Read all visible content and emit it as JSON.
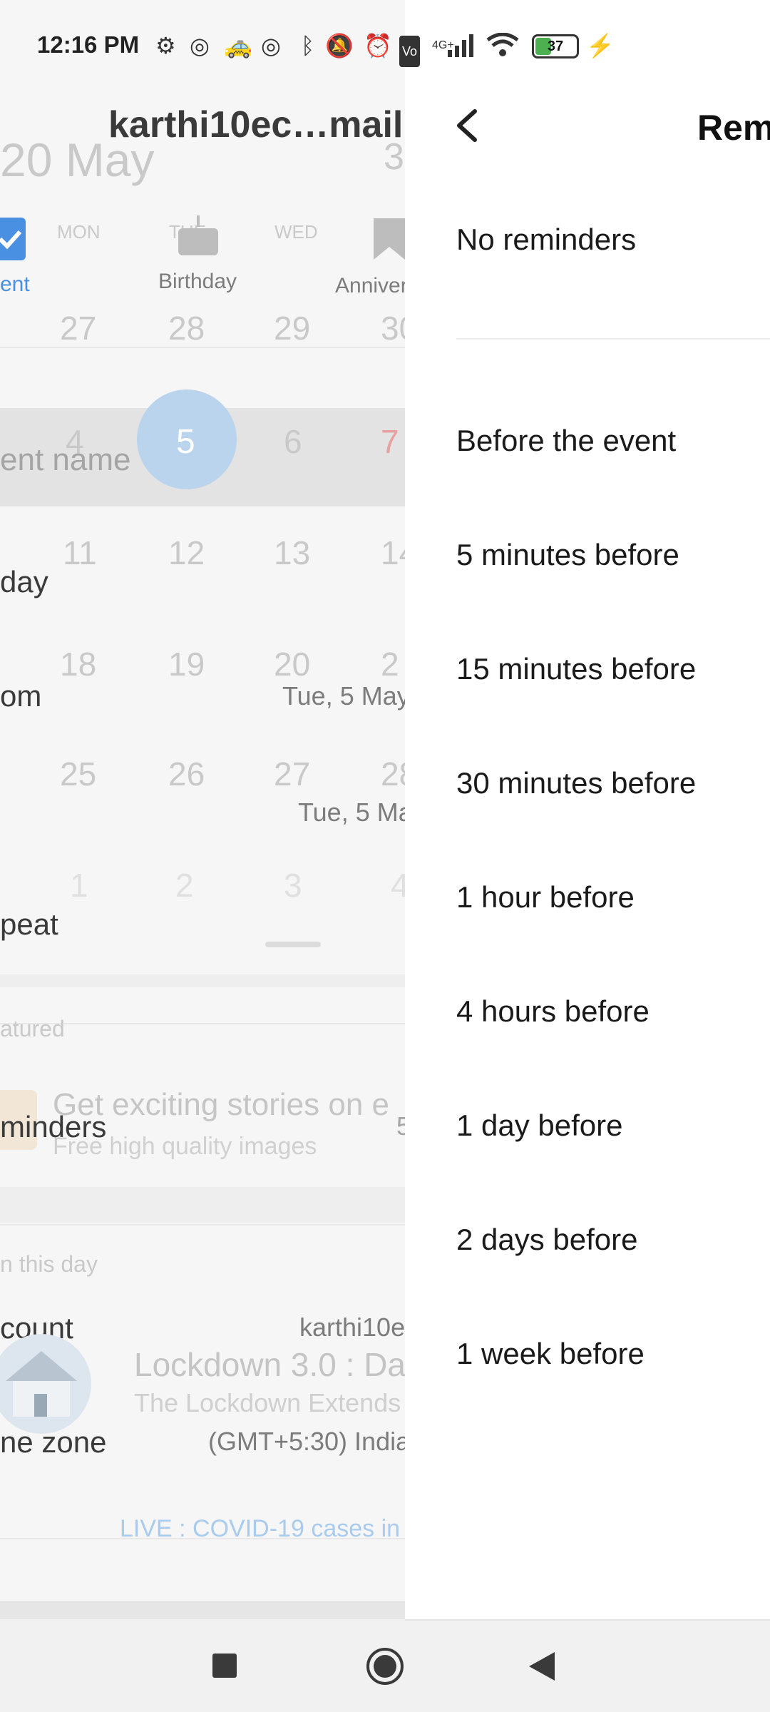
{
  "status_bar": {
    "time": "12:16 PM",
    "battery_level": "37",
    "network": "4G+",
    "icons": [
      "settings-icon",
      "app-icon",
      "taxi-icon",
      "app-icon",
      "bluetooth-icon",
      "dnd-icon",
      "alarm-icon",
      "volte-icon",
      "signal-icon",
      "wifi-icon",
      "battery-icon",
      "charging-icon"
    ]
  },
  "background": {
    "account_header": "karthi10ec…mail.",
    "month_label": "20 May",
    "weekdays": [
      "MON",
      "TUE",
      "WED",
      "TH"
    ],
    "event_types": [
      "ent",
      "Birthday",
      "Anniver"
    ],
    "week_rows": [
      [
        "27",
        "28",
        "29",
        "30"
      ],
      [
        "4",
        "5",
        "6",
        "7"
      ],
      [
        "11",
        "12",
        "13",
        "14"
      ],
      [
        "18",
        "19",
        "20",
        "2"
      ],
      [
        "25",
        "26",
        "27",
        "28"
      ],
      [
        "1",
        "2",
        "3",
        "4"
      ]
    ],
    "selected_day": "5",
    "form_labels": {
      "event_name": "ent name",
      "all_day": "day",
      "from": "om",
      "to_date_1": "Tue, 5 May",
      "to_date_2": "Tue, 5 Ma",
      "repeat": "peat",
      "featured": "atured",
      "story_title": "Get exciting stories on e",
      "story_sub": "Free high quality images",
      "reminders": "minders",
      "reminders_value": "5",
      "on_this_day": "n this day",
      "account": "count",
      "account_value": "karthi10e",
      "news_title": "Lockdown 3.0 : Day",
      "news_sub": "The Lockdown Extends",
      "time_zone": "ne zone",
      "time_zone_value": "(GMT+5:30) India",
      "live_link": "LIVE : COVID-19 cases in"
    }
  },
  "panel": {
    "title": "Rem",
    "no_reminders": "No reminders",
    "options": [
      "Before the event",
      "5 minutes before",
      "15 minutes before",
      "30 minutes before",
      "1 hour before",
      "4 hours before",
      "1 day before",
      "2 days before",
      "1 week before"
    ]
  },
  "colors": {
    "accent_blue": "#4a90e2",
    "selected_circle": "#b9d4ec",
    "weekend_red": "#e8a0a0"
  }
}
